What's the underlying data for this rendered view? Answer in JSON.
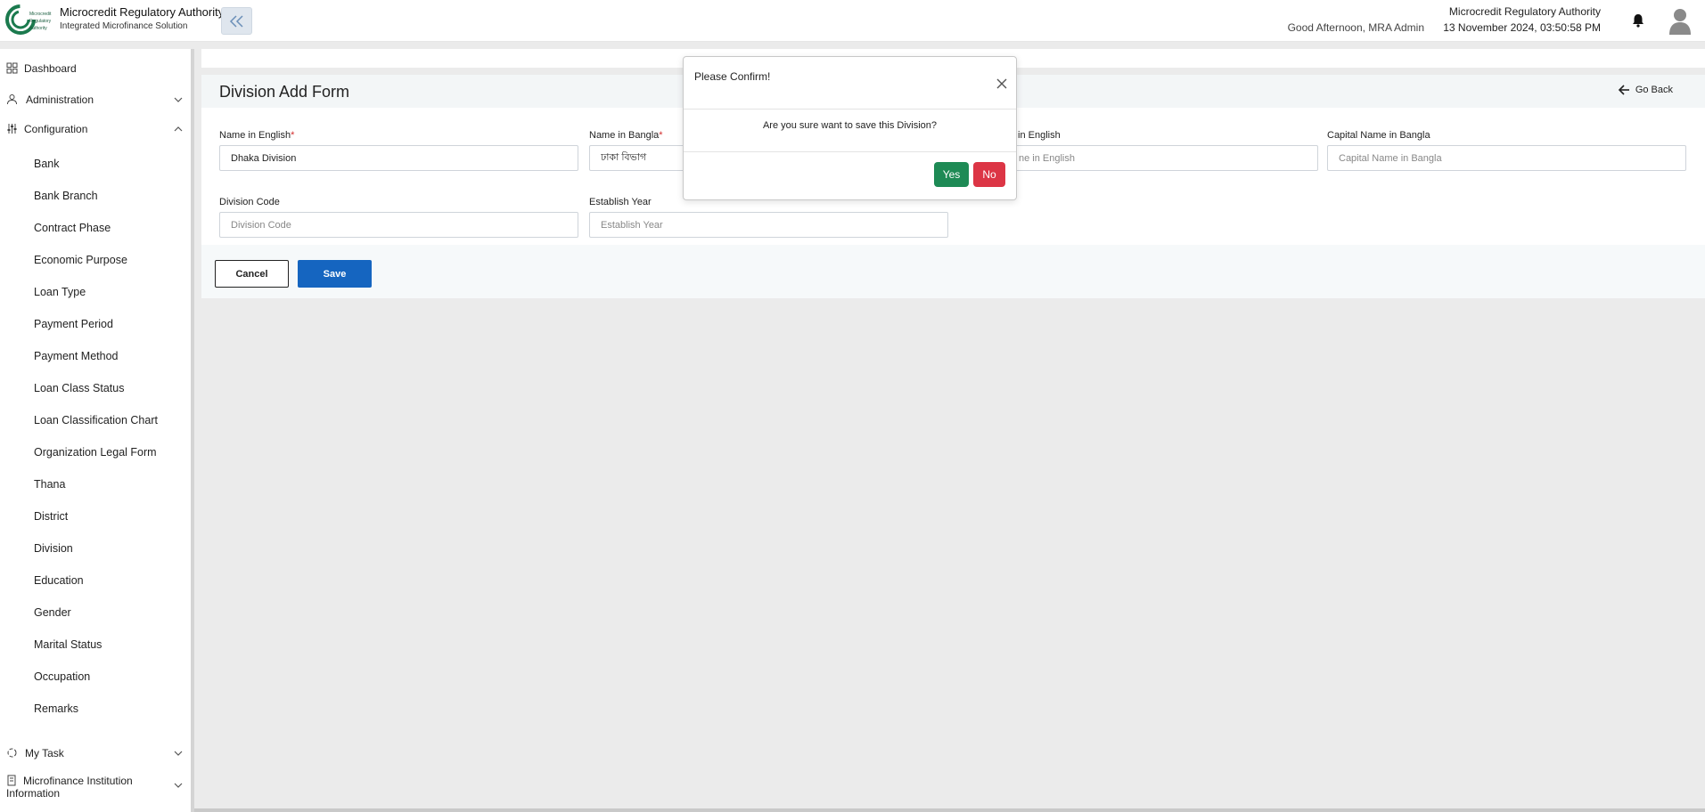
{
  "header": {
    "logo_text": "Microcredit Regulatory Authority",
    "title": "Microcredit Regulatory Authority",
    "subtitle": "Integrated Microfinance Solution",
    "greeting": "Good Afternoon, MRA Admin",
    "org_name": "Microcredit Regulatory Authority",
    "datetime": "13 November 2024, 03:50:58 PM",
    "icons": {
      "collapse": "double-chevron-left-icon",
      "notification": "bell-icon",
      "user": "user-avatar-icon"
    }
  },
  "sidebar": {
    "dashboard": "Dashboard",
    "administration": "Administration",
    "configuration": "Configuration",
    "config_items": [
      "Bank",
      "Bank Branch",
      "Contract Phase",
      "Economic Purpose",
      "Loan Type",
      "Payment Period",
      "Payment Method",
      "Loan Class Status",
      "Loan Classification Chart",
      "Organization Legal Form",
      "Thana",
      "District",
      "Division",
      "Education",
      "Gender",
      "Marital Status",
      "Occupation",
      "Remarks"
    ],
    "my_task": "My Task",
    "mfi_info": "Microfinance Institution Information"
  },
  "form": {
    "title": "Division Add Form",
    "go_back": "Go Back",
    "fields": {
      "name_en": {
        "label": "Name in English",
        "required": "*",
        "value": "Dhaka Division"
      },
      "name_bn": {
        "label": "Name in Bangla",
        "required": "*",
        "value": "ঢাকা বিভাগ"
      },
      "capital_en": {
        "label": "in English",
        "placeholder": "ne in English"
      },
      "capital_bn": {
        "label": "Capital Name in Bangla",
        "placeholder": "Capital Name in Bangla"
      },
      "division_code": {
        "label": "Division Code",
        "placeholder": "Division Code"
      },
      "establish_year": {
        "label": "Establish Year",
        "placeholder": "Establish Year"
      }
    },
    "cancel_label": "Cancel",
    "save_label": "Save"
  },
  "modal": {
    "title": "Please Confirm!",
    "message": "Are you sure want to save this Division?",
    "yes_label": "Yes",
    "no_label": "No"
  },
  "colors": {
    "primary": "#1565c0",
    "yes": "#1e8a55",
    "no": "#dc3545",
    "required": "#d32f2f",
    "logo_green": "#1b7a4e"
  }
}
